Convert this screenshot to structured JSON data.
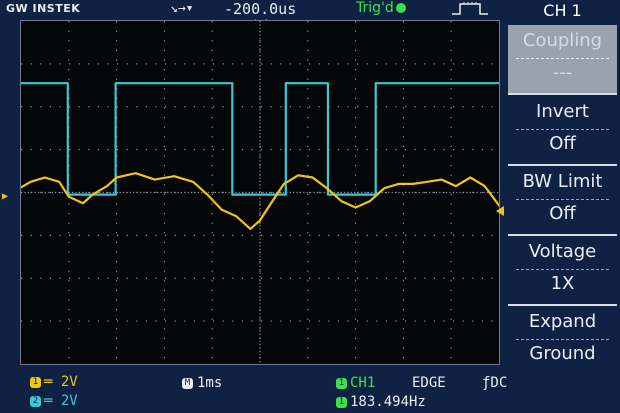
{
  "header": {
    "brand": "GW INSTEK",
    "horizontal_position_icon": "↘→▾",
    "horizontal_position": "-200.0us",
    "trigger_status": "Trig'd",
    "trigger_icon": "pulse-edge-icon"
  },
  "menu": {
    "title": "CH 1",
    "items": [
      {
        "label": "Coupling",
        "value": "---",
        "selected": true
      },
      {
        "label": "Invert",
        "value": "Off"
      },
      {
        "label": "BW Limit",
        "value": "Off"
      },
      {
        "label": "Voltage",
        "value": "1X"
      },
      {
        "label": "Expand",
        "value": "Ground"
      }
    ]
  },
  "status": {
    "ch1_badge": "1",
    "ch1_scale": "═ 2V",
    "ch2_badge": "2",
    "ch2_scale": "═ 2V",
    "timebase_badge": "M",
    "timebase": "1ms",
    "trigger_badge": "1",
    "trigger_source": "CH1",
    "trigger_type": "EDGE",
    "trigger_coupling": "ƒDC",
    "freq_badge": "1",
    "frequency": "183.494Hz"
  },
  "colors": {
    "ch1": "#f0c419",
    "ch2": "#3bc7d4",
    "trigger": "#3be14a",
    "background": "#0f2244",
    "graticule_bg": "#050607",
    "grid": "#8a93a3"
  },
  "chart_data": {
    "type": "line",
    "x_unit": "div",
    "y_unit": "div",
    "xlim": [
      0,
      10
    ],
    "ylim": [
      -4,
      4
    ],
    "series": [
      {
        "name": "CH2",
        "color": "#3bc7d4",
        "x": [
          0,
          0.98,
          0.98,
          1.98,
          1.98,
          4.42,
          4.42,
          5.54,
          5.54,
          6.42,
          6.42,
          7.42,
          7.42,
          10
        ],
        "y": [
          2.55,
          2.55,
          -0.05,
          -0.05,
          2.55,
          2.55,
          -0.05,
          -0.05,
          2.55,
          2.55,
          -0.05,
          -0.05,
          2.55,
          2.55
        ]
      },
      {
        "name": "CH1",
        "color": "#f0c419",
        "x": [
          0,
          0.2,
          0.5,
          0.8,
          1.0,
          1.3,
          1.5,
          1.8,
          2.0,
          2.4,
          2.8,
          3.2,
          3.6,
          3.9,
          4.2,
          4.5,
          4.8,
          5.0,
          5.2,
          5.5,
          5.8,
          6.1,
          6.4,
          6.7,
          7.0,
          7.3,
          7.6,
          7.9,
          8.2,
          8.5,
          8.8,
          9.1,
          9.4,
          9.7,
          10
        ],
        "y": [
          0.12,
          0.25,
          0.35,
          0.25,
          -0.1,
          -0.25,
          -0.05,
          0.15,
          0.35,
          0.45,
          0.3,
          0.38,
          0.25,
          -0.05,
          -0.4,
          -0.55,
          -0.85,
          -0.65,
          -0.3,
          0.2,
          0.4,
          0.35,
          0.1,
          -0.2,
          -0.35,
          -0.2,
          0.1,
          0.2,
          0.2,
          0.25,
          0.3,
          0.15,
          0.35,
          0.15,
          -0.3
        ]
      }
    ],
    "grid": true,
    "divisions": {
      "x": 10,
      "y": 8
    }
  }
}
